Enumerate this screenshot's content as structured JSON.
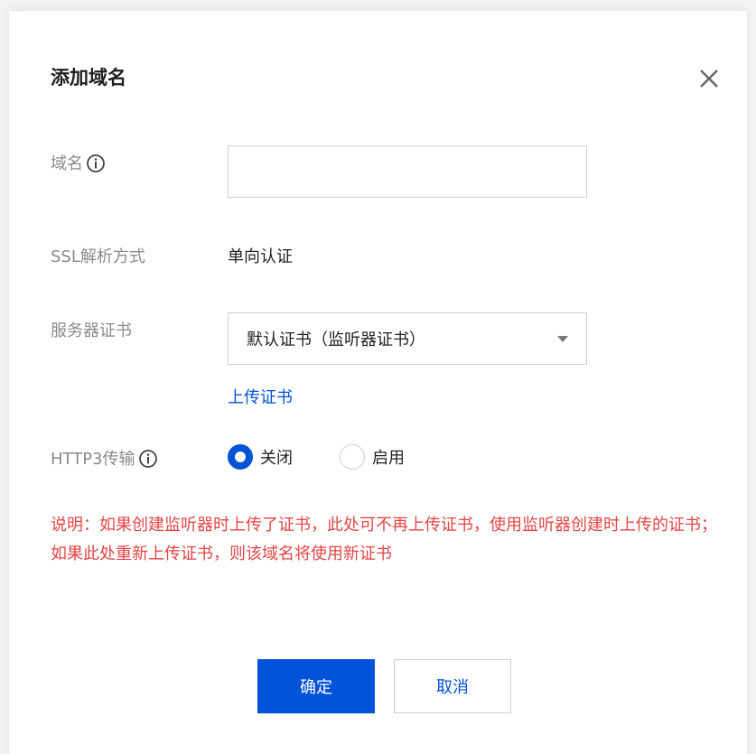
{
  "dialog": {
    "title": "添加域名",
    "close_icon": "close-icon"
  },
  "form": {
    "domain": {
      "label": "域名",
      "icon": "info-icon",
      "value": "",
      "placeholder": ""
    },
    "ssl": {
      "label": "SSL解析方式",
      "value": "单向认证"
    },
    "certificate": {
      "label": "服务器证书",
      "selected": "默认证书（监听器证书）",
      "upload_link": "上传证书"
    },
    "http3": {
      "label": "HTTP3传输",
      "icon": "info-icon",
      "options": [
        {
          "label": "关闭",
          "checked": true
        },
        {
          "label": "启用",
          "checked": false
        }
      ]
    }
  },
  "note": "说明：如果创建监听器时上传了证书，此处可不再上传证书，使用监听器创建时上传的证书；如果此处重新上传证书，则该域名将使用新证书",
  "buttons": {
    "confirm": "确定",
    "cancel": "取消"
  },
  "colors": {
    "primary": "#0052d9",
    "warning_text": "#e54545",
    "label_text": "#8a8a8a"
  }
}
